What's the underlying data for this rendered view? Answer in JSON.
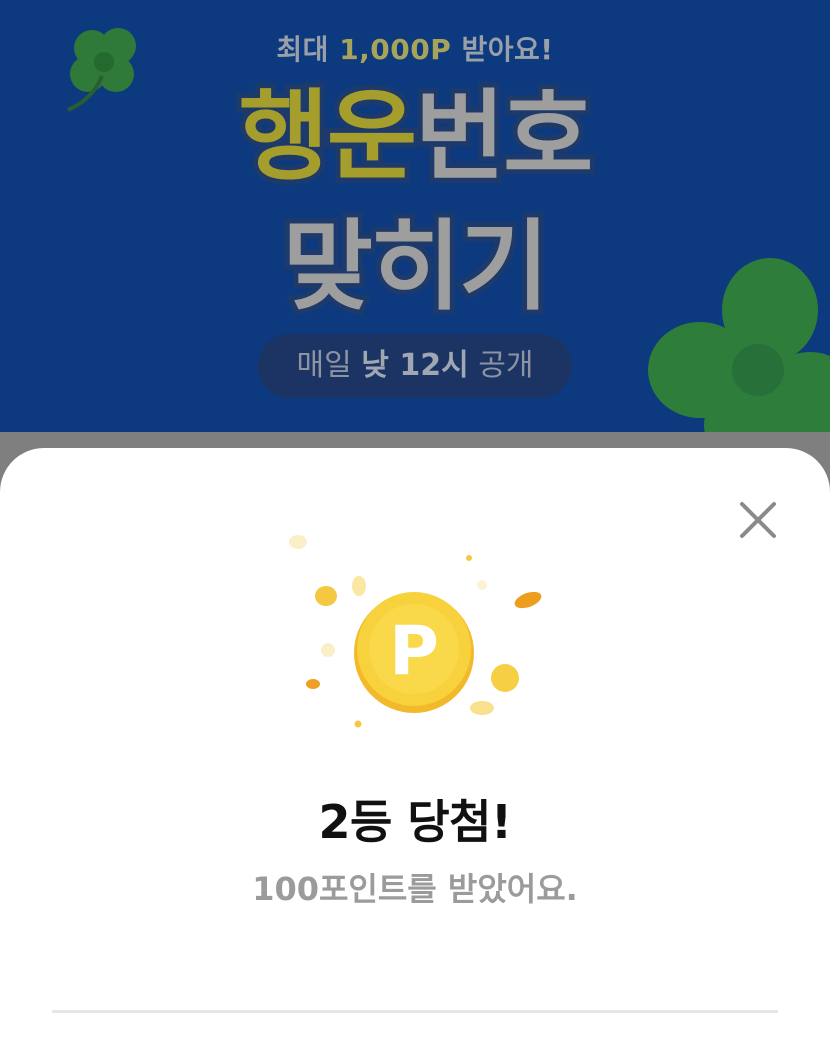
{
  "banner": {
    "subtitle_prefix": "최대",
    "subtitle_highlight": "1,000P",
    "subtitle_suffix": "받아요!",
    "title_yellow": "행운",
    "title_gray": "번호",
    "title_line2": "맞히기",
    "schedule_prefix": "매일",
    "schedule_bold": "낮 12시",
    "schedule_suffix": "공개"
  },
  "sheet": {
    "coin_label": "P",
    "headline": "2등 당첨!",
    "message": "100포인트를 받았어요."
  },
  "colors": {
    "banner_bg": "#0d3a7e",
    "coin": "#f7cc33",
    "clover": "#2b8a3e",
    "headline": "#111111",
    "message": "#9b9b9b"
  }
}
